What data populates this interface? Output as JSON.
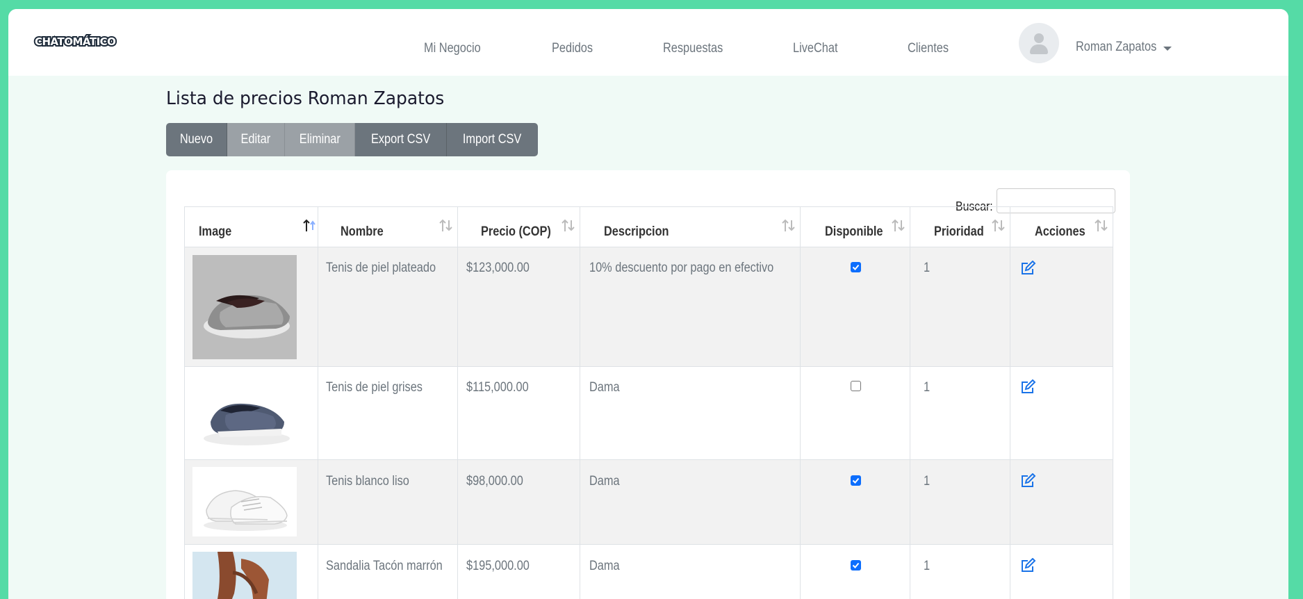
{
  "brand": {
    "logo_text": "CHATOMÁTICO"
  },
  "nav": {
    "links": [
      "Mi Negocio",
      "Pedidos",
      "Respuestas",
      "LiveChat",
      "Clientes"
    ],
    "user_name": "Roman Zapatos"
  },
  "page": {
    "title": "Lista de precios Roman Zapatos",
    "buttons": {
      "new": "Nuevo",
      "edit": "Editar",
      "delete": "Eliminar",
      "export": "Export CSV",
      "import": "Import CSV"
    }
  },
  "search": {
    "label": "Buscar:",
    "value": ""
  },
  "table": {
    "columns": [
      "Image",
      "Nombre",
      "Precio (COP)",
      "Descripcion",
      "Disponible",
      "Prioridad",
      "Acciones"
    ],
    "sorted_column": "Image",
    "rows": [
      {
        "image": "silver-slip-on-shoes",
        "name": "Tenis de piel plateado",
        "price": "$123,000.00",
        "description": "10% descuento por pago en efectivo",
        "available": true,
        "priority": "1"
      },
      {
        "image": "grey-slip-on-shoes",
        "name": "Tenis de piel grises",
        "price": "$115,000.00",
        "description": "Dama",
        "available": false,
        "priority": "1"
      },
      {
        "image": "white-sneakers",
        "name": "Tenis blanco liso",
        "price": "$98,000.00",
        "description": "Dama",
        "available": true,
        "priority": "1"
      },
      {
        "image": "brown-heeled-sandal",
        "name": "Sandalia Tacón marrón",
        "price": "$195,000.00",
        "description": "Dama",
        "available": true,
        "priority": "1"
      }
    ]
  },
  "colors": {
    "background": "#55dba6",
    "button": "#6c757d",
    "button_disabled": "#9ba1a6",
    "checkbox": "#0d6efd",
    "edit_icon": "#1a73e8"
  },
  "icons": {
    "avatar": "user-placeholder-icon",
    "dropdown": "caret-down-icon",
    "sort": "sort-arrows-icon",
    "edit": "edit-square-icon"
  }
}
